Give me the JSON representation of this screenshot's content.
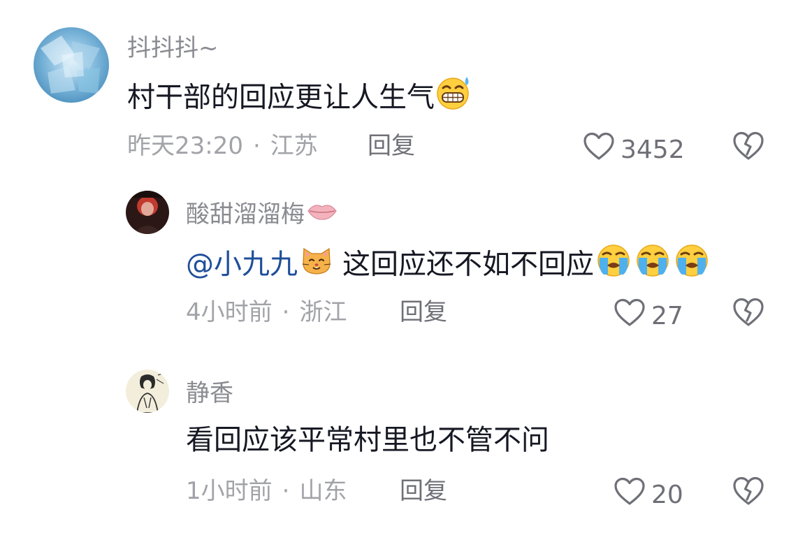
{
  "comments": [
    {
      "username": "抖抖抖~",
      "text": "村干部的回应更让人生气",
      "emoji": "grinning-sweat-emoji",
      "time": "昨天23:20",
      "location": "江苏",
      "reply_label": "回复",
      "likes": "3452"
    },
    {
      "username": "酸甜溜溜梅",
      "name_emoji": "lips-emoji",
      "mention": "@小九九",
      "mention_emoji": "cat-face-emoji",
      "text": "这回应还不如不回应",
      "trailing_emojis": [
        "crying-face-emoji",
        "crying-face-emoji",
        "crying-face-emoji"
      ],
      "time": "4小时前",
      "location": "浙江",
      "reply_label": "回复",
      "likes": "27"
    },
    {
      "username": "静香",
      "text": "看回应该平常村里也不管不问",
      "time": "1小时前",
      "location": "山东",
      "reply_label": "回复",
      "likes": "20"
    }
  ],
  "separator": "·",
  "colors": {
    "primary_text": "#161823",
    "username": "#8a8b91",
    "meta": "#a2a3a8",
    "action": "#6f7077",
    "mention": "#1f4f9b"
  }
}
